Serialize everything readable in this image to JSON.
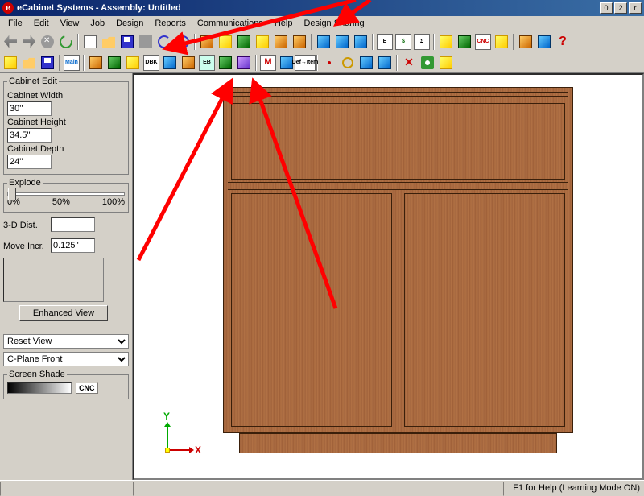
{
  "window": {
    "title": "eCabinet Systems - Assembly: Untitled",
    "icon_letter": "e"
  },
  "menu": [
    "File",
    "Edit",
    "View",
    "Job",
    "Design",
    "Reports",
    "Communications",
    "Help",
    "Design Sharing"
  ],
  "sidebar": {
    "group_title": "Cabinet Edit",
    "width_label": "Cabinet Width",
    "width_value": "30''",
    "height_label": "Cabinet Height",
    "height_value": "34.5''",
    "depth_label": "Cabinet Depth",
    "depth_value": "24''",
    "explode_label": "Explode",
    "explode_0": "0%",
    "explode_50": "50%",
    "explode_100": "100%",
    "dist_label": "3-D Dist.",
    "dist_value": "",
    "move_label": "Move Incr.",
    "move_value": "0.125''",
    "enhanced_btn": "Enhanced View",
    "reset_view": "Reset View",
    "cplane": "C-Plane Front",
    "shade_label": "Screen Shade",
    "cnc_label": "CNC"
  },
  "toolbar1": {
    "cnc": "CNC",
    "sigma": "Σ",
    "dollar": "$",
    "e_letter": "E"
  },
  "toolbar2": {
    "main": "Main",
    "dbx": "DBK",
    "eb": "EB",
    "m": "M",
    "def_item": "Def→Item"
  },
  "axis": {
    "x": "X",
    "y": "Y"
  },
  "status": {
    "help": "F1 for Help (Learning Mode ON)"
  }
}
